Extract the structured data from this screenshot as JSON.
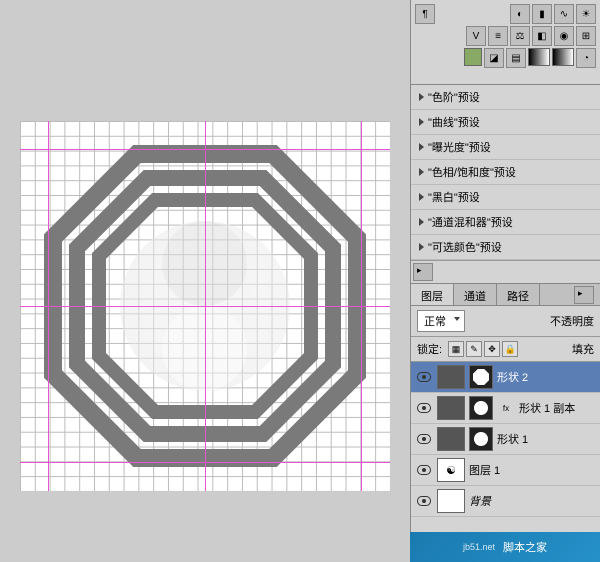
{
  "presets": {
    "items": [
      {
        "label": "\"色阶\"预设"
      },
      {
        "label": "\"曲线\"预设"
      },
      {
        "label": "\"曝光度\"预设"
      },
      {
        "label": "\"色相/饱和度\"预设"
      },
      {
        "label": "\"黑白\"预设"
      },
      {
        "label": "\"通道混和器\"预设"
      },
      {
        "label": "\"可选颜色\"预设"
      }
    ]
  },
  "layers_panel": {
    "tabs": {
      "layers": "图层",
      "channels": "通道",
      "paths": "路径"
    },
    "blend_mode": "正常",
    "opacity_label": "不透明度",
    "lock_label": "锁定:",
    "fill_label": "填充",
    "layers": [
      {
        "name": "形状 2",
        "selected": true,
        "has_mask": "octagon"
      },
      {
        "name": "形状 1 副本",
        "has_mask": "circle",
        "fx": true
      },
      {
        "name": "形状 1",
        "has_mask": "circle"
      },
      {
        "name": "图层 1"
      },
      {
        "name": "背景"
      }
    ]
  },
  "watermark": {
    "site": "jb51.net",
    "text": "脚本之家"
  }
}
